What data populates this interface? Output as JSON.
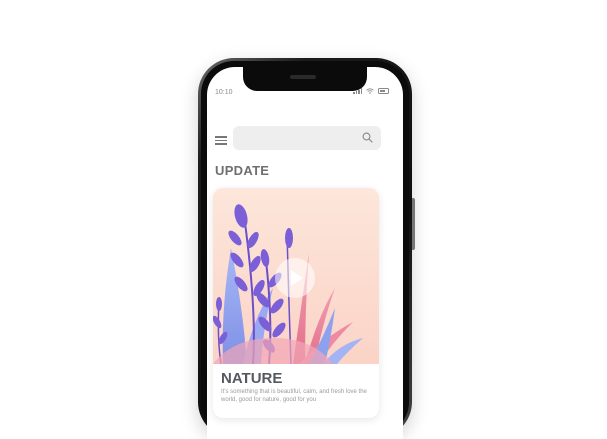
{
  "status_bar": {
    "time": "10:10"
  },
  "section": {
    "title": "UPDATE"
  },
  "card": {
    "title": "NATURE",
    "description": "It's something that is beautiful, calm, and fresh love the world, good for nature, good for you"
  },
  "icons": {
    "menu": "hamburger-menu-icon",
    "search": "search-icon",
    "play": "play-icon",
    "signal": "signal-icon",
    "wifi": "wifi-icon",
    "battery": "battery-icon"
  },
  "colors": {
    "card_background": "#fde3d6",
    "leaf_purple": "#7b5fd6",
    "leaf_pink": "#f08aa0",
    "leaf_blue": "#8da6f0",
    "title_text": "#555a60"
  }
}
